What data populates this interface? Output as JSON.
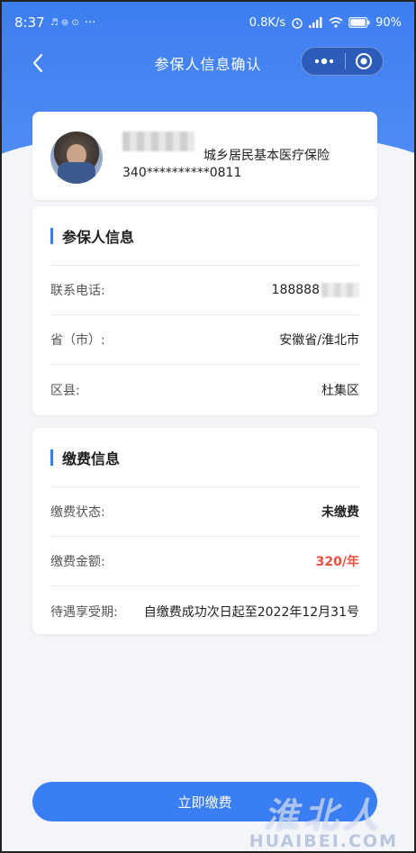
{
  "status_bar": {
    "time": "8:37",
    "notif_icons": "♬ ⊛ ⊙",
    "more": "···",
    "speed": "0.8K/s",
    "battery": "90"
  },
  "nav": {
    "title": "参保人信息确认"
  },
  "profile": {
    "plan": "城乡居民基本医疗保险",
    "id_number": "340**********0811"
  },
  "insured_section": {
    "title": "参保人信息",
    "rows": [
      {
        "label": "联系电话:",
        "value": "188888"
      },
      {
        "label": "省（市）:",
        "value": "安徽省/淮北市"
      },
      {
        "label": "区县:",
        "value": "杜集区"
      }
    ]
  },
  "payment_section": {
    "title": "缴费信息",
    "rows": [
      {
        "label": "缴费状态:",
        "value": "未缴费"
      },
      {
        "label": "缴费金额:",
        "value": "320/年"
      },
      {
        "label": "待遇享受期:",
        "value": "自缴费成功次日起至2022年12月31号"
      }
    ]
  },
  "actions": {
    "pay_now": "立即缴费"
  },
  "watermark": {
    "cn": "淮北人",
    "en": "HUAIBEI.COM"
  },
  "colors": {
    "primary": "#3a7ef4",
    "accent_red": "#e8523f",
    "page_bg": "#f3f5f9"
  }
}
